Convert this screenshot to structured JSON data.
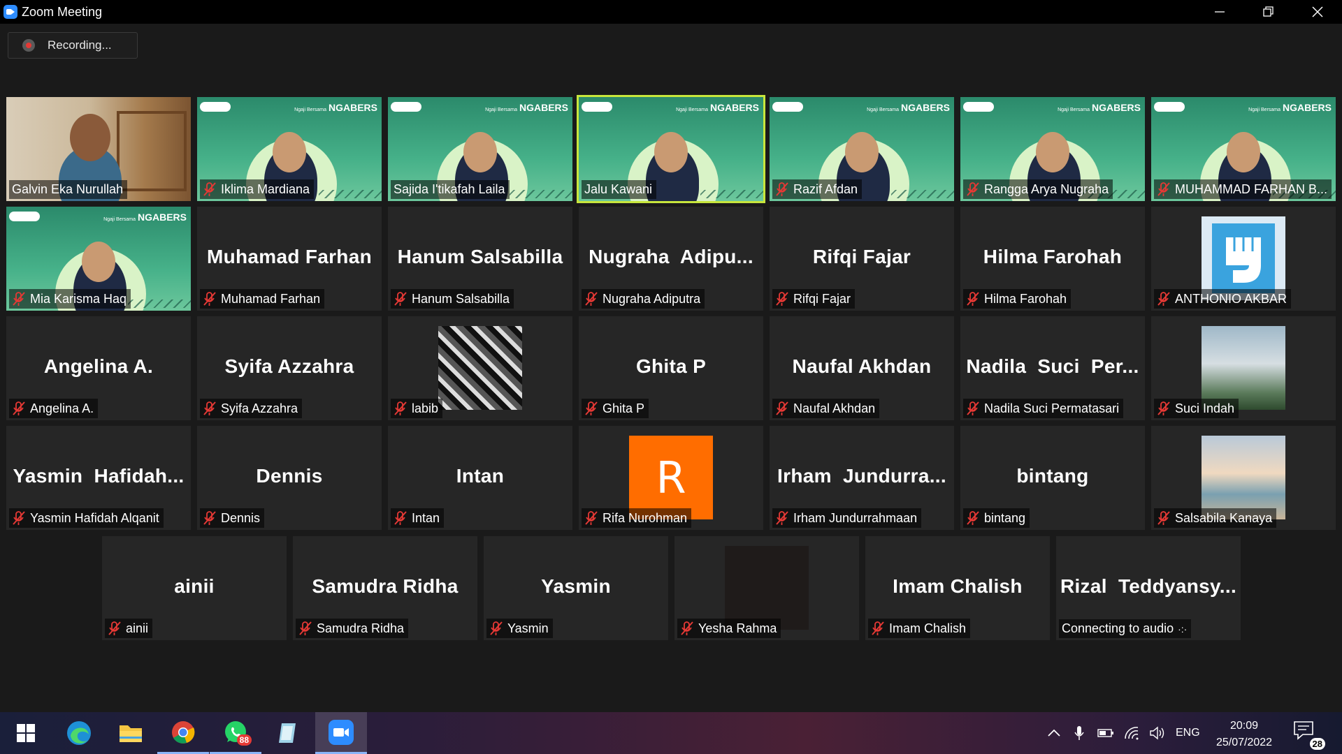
{
  "window": {
    "title": "Zoom Meeting"
  },
  "recording": {
    "label": "Recording..."
  },
  "tiles": [
    {
      "name": "Galvin Eka Nurullah",
      "muted": false,
      "type": "webcam"
    },
    {
      "name": "Iklima Mardiana",
      "muted": true,
      "type": "green",
      "brand": "NGABERS",
      "brand_small": "Ngaji Bersama"
    },
    {
      "name": "Sajida I'tikafah Laila",
      "muted": false,
      "type": "green",
      "brand": "NGABERS",
      "brand_small": "Ngaji Bersama"
    },
    {
      "name": "Jalu Kawani",
      "muted": false,
      "type": "green",
      "active": true,
      "brand": "NGABERS",
      "brand_small": "Ngaji Bersama"
    },
    {
      "name": "Razif Afdan",
      "muted": true,
      "type": "green",
      "brand": "NGABERS",
      "brand_small": "Ngaji Bersama"
    },
    {
      "name": "Rangga Arya Nugraha",
      "muted": true,
      "type": "green",
      "brand": "NGABERS",
      "brand_small": "Ngaji Bersama"
    },
    {
      "name": "MUHAMMAD FARHAN B...",
      "muted": true,
      "type": "green",
      "brand": "NGABERS",
      "brand_small": "Ngaji Bersama"
    },
    {
      "name": "Mia Karisma Haq",
      "muted": true,
      "type": "green",
      "brand": "NGABERS",
      "brand_small": "Ngaji Bersama"
    },
    {
      "name": "Muhamad Farhan",
      "big": "Muhamad Farhan",
      "muted": true
    },
    {
      "name": "Hanum Salsabilla",
      "big": "Hanum Salsabilla",
      "muted": true
    },
    {
      "name": "Nugraha Adiputra",
      "big": "Nugraha  Adipu...",
      "muted": true
    },
    {
      "name": "Rifqi Fajar",
      "big": "Rifqi Fajar",
      "muted": true
    },
    {
      "name": "Hilma Farohah",
      "big": "Hilma Farohah",
      "muted": true
    },
    {
      "name": "ANTHONIO AKBAR",
      "muted": true,
      "type": "fist"
    },
    {
      "name": "Angelina A.",
      "big": "Angelina A.",
      "muted": true
    },
    {
      "name": "Syifa Azzahra",
      "big": "Syifa Azzahra",
      "muted": true
    },
    {
      "name": "labib",
      "muted": true,
      "type": "collage"
    },
    {
      "name": "Ghita P",
      "big": "Ghita P",
      "muted": true
    },
    {
      "name": "Naufal Akhdan",
      "big": "Naufal Akhdan",
      "muted": true
    },
    {
      "name": "Nadila Suci Permatasari",
      "big": "Nadila  Suci  Per...",
      "muted": true
    },
    {
      "name": "Suci Indah",
      "muted": true,
      "type": "sky"
    },
    {
      "name": "Yasmin Hafidah Alqanit",
      "big": "Yasmin  Hafidah...",
      "muted": true
    },
    {
      "name": "Dennis",
      "big": "Dennis",
      "muted": true
    },
    {
      "name": "Intan",
      "big": "Intan",
      "muted": true
    },
    {
      "name": "Rifa Nurohman",
      "muted": true,
      "type": "letter",
      "letter": "R"
    },
    {
      "name": "Irham Jundurrahmaan",
      "big": "Irham  Jundurra...",
      "muted": true
    },
    {
      "name": "bintang",
      "big": "bintang",
      "muted": true
    },
    {
      "name": "Salsabila Kanaya",
      "muted": true,
      "type": "beach"
    },
    {
      "name": "ainii",
      "big": "ainii",
      "muted": true
    },
    {
      "name": "Samudra Ridha",
      "big": "Samudra Ridha",
      "muted": true
    },
    {
      "name": "Yasmin",
      "big": "Yasmin",
      "muted": true
    },
    {
      "name": "Yesha Rahma",
      "muted": true,
      "type": "dark"
    },
    {
      "name": "Imam Chalish",
      "big": "Imam Chalish",
      "muted": true
    },
    {
      "name": "Connecting to audio",
      "big": "Rizal  Teddyansy...",
      "muted": false,
      "connecting": true
    }
  ],
  "taskbar": {
    "whatsapp_badge": "88",
    "language": "ENG",
    "time": "20:09",
    "date": "25/07/2022",
    "notifications": "28"
  },
  "colors": {
    "active_speaker": "#c8e63c",
    "zoom_blue": "#2d8cff",
    "mute_red": "#e53935"
  }
}
